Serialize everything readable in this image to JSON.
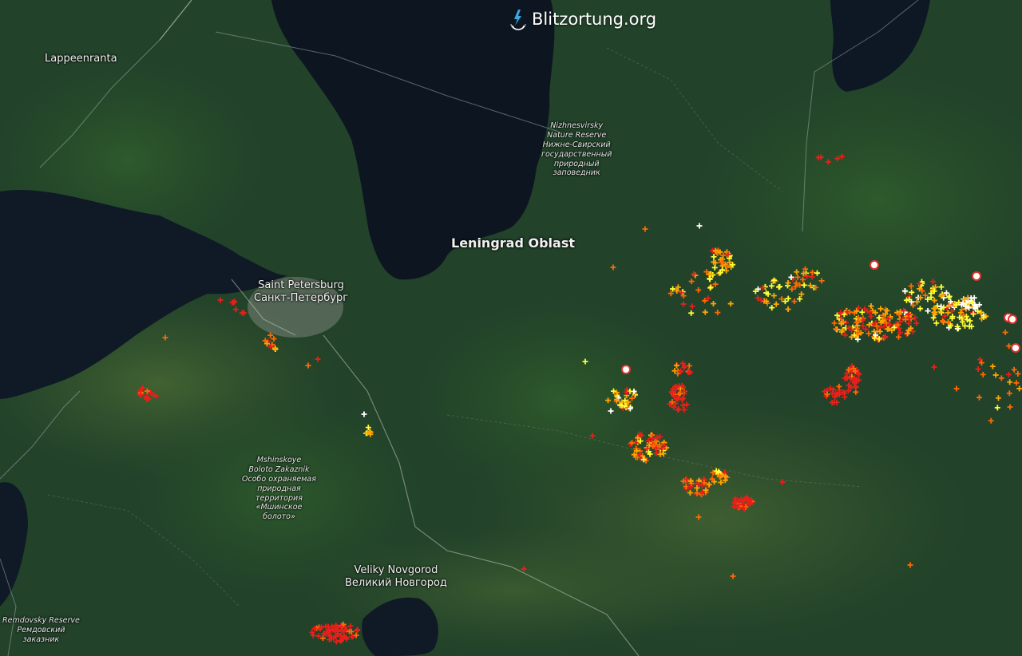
{
  "brand": {
    "name": "Blitzortung.org",
    "icon": "lightning-bolt-icon"
  },
  "labels": {
    "lappeenranta": "Lappeenranta",
    "spb_en": "Saint Petersburg",
    "spb_ru": "Санкт-Петербург",
    "leningrad_oblast": "Leningrad Oblast",
    "novgorod_en": "Veliky Novgorod",
    "novgorod_ru": "Великий Новгород",
    "nizhnesvirsky": [
      "Nizhnesvirsky",
      "Nature Reserve",
      "Нижне-Свирский",
      "государственный",
      "природный",
      "заповедник"
    ],
    "mshinskoye": [
      "Mshinskoye",
      "Boloto Zakaznik",
      "Особо охраняемая",
      "природная",
      "территория",
      "«Мшинское",
      "болото»"
    ],
    "remdovsky": [
      "Remdovsky Reserve",
      "Ремдовский",
      "заказник"
    ]
  },
  "strike_colors": {
    "newest": "#ffffff",
    "recent": "#ffff33",
    "mid": "#ffa500",
    "older": "#ff6a00",
    "oldest": "#e8201a",
    "detector": "#e0342c"
  }
}
